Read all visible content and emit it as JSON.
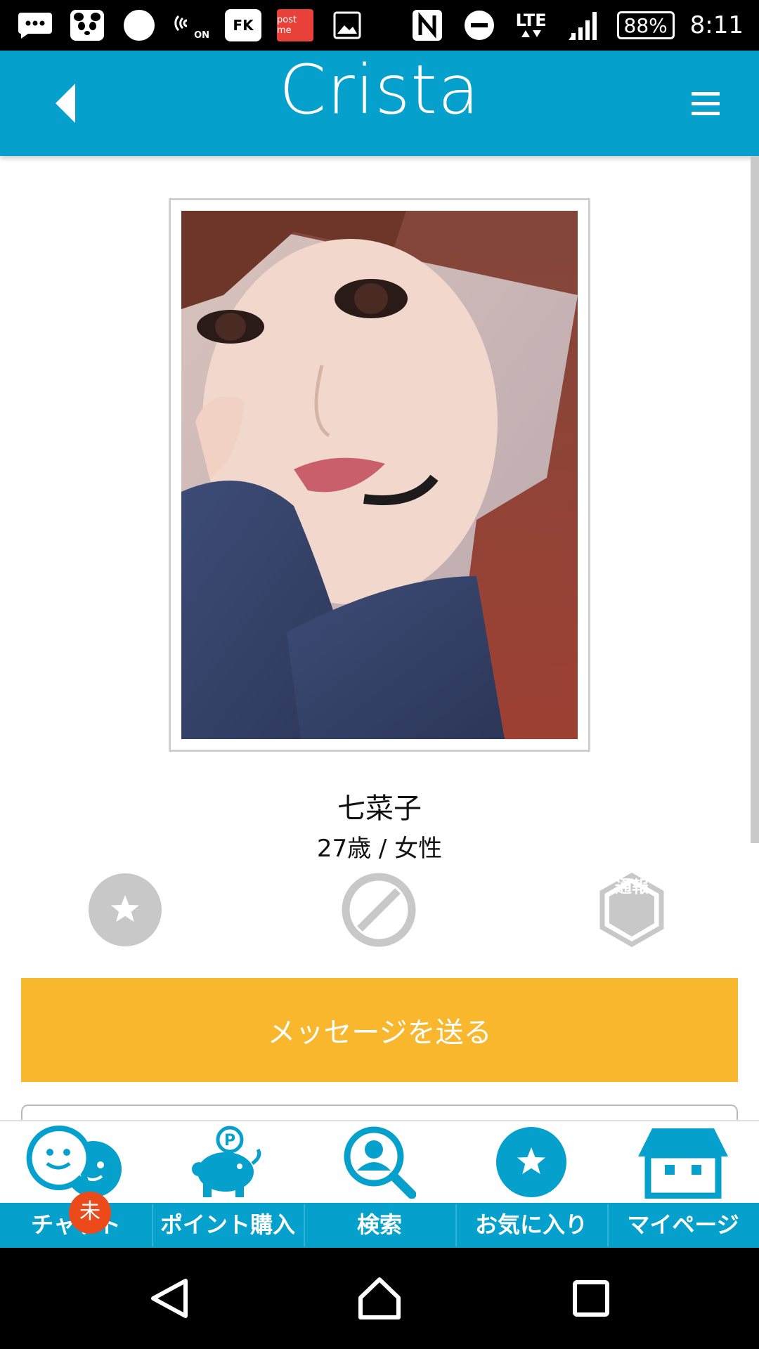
{
  "status_bar": {
    "app_icons": [
      "messages-icon",
      "panda-app-icon",
      "circle-app-icon",
      "nfc-on-icon",
      "fk-app-icon",
      "postme-app-icon",
      "gallery-icon"
    ],
    "fk_label": "FK",
    "postme_label": "post me",
    "nfc_on_label": "ON",
    "network_label": "LTE",
    "battery": "88%",
    "time": "8:11"
  },
  "header": {
    "title": "Crista",
    "color": "#05a0cb"
  },
  "profile": {
    "name": "七菜子",
    "meta": "27歳 / 女性",
    "report_label": "通報"
  },
  "actions": {
    "message_label": "メッセージを送る",
    "message_color": "#f8b72d"
  },
  "tabs": [
    {
      "id": "chat",
      "label": "チャット",
      "icon": "chat-icon"
    },
    {
      "id": "points",
      "label": "ポイント購入",
      "icon": "piggy-bank-icon"
    },
    {
      "id": "search",
      "label": "検索",
      "icon": "search-user-icon"
    },
    {
      "id": "favorites",
      "label": "お気に入り",
      "icon": "star-icon"
    },
    {
      "id": "mypage",
      "label": "マイページ",
      "icon": "house-icon"
    }
  ],
  "chat_badge": "未",
  "nav_bar": {
    "buttons": [
      "back-triangle-icon",
      "home-icon",
      "recents-icon"
    ]
  }
}
